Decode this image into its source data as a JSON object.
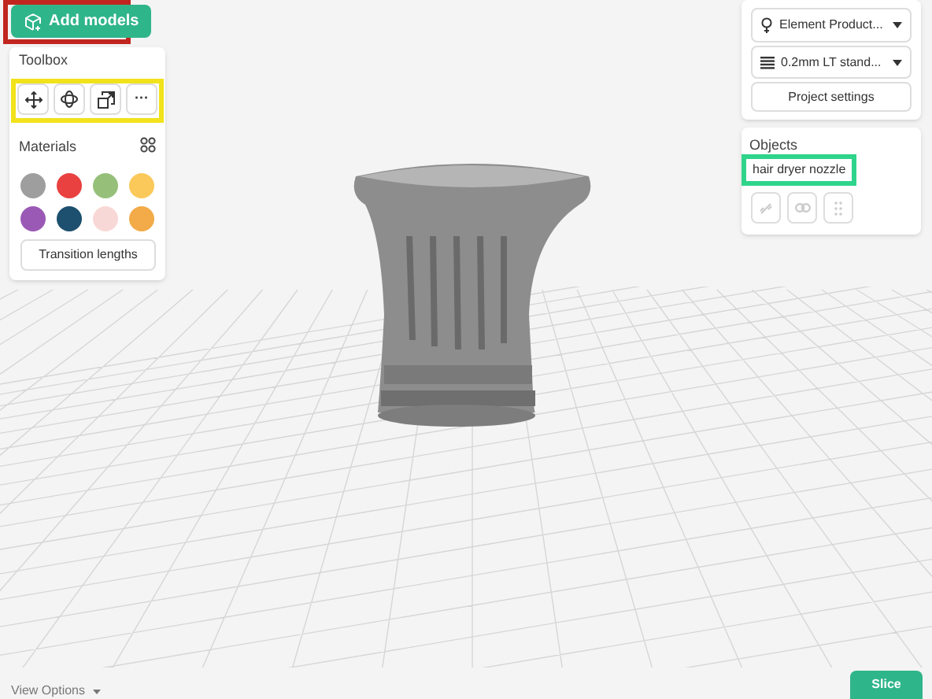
{
  "add_models_button": "Add models",
  "toolbox": {
    "title": "Toolbox",
    "tools": [
      {
        "kind": "move"
      },
      {
        "kind": "rotate"
      },
      {
        "kind": "scale"
      },
      {
        "kind": "more",
        "label": "···"
      }
    ]
  },
  "materials": {
    "title": "Materials",
    "swatches": [
      {
        "color": "#9e9e9e"
      },
      {
        "color": "#e8413f"
      },
      {
        "color": "#96c07a"
      },
      {
        "color": "#fbc95a"
      },
      {
        "color": "#9a59b5"
      },
      {
        "color": "#1d4f6e"
      },
      {
        "color": "#f8d8d6"
      },
      {
        "color": "#f2ab48"
      }
    ],
    "button": "Transition lengths"
  },
  "printer": {
    "printer_dropdown": "Element Product...",
    "profile_dropdown": "0.2mm LT stand...",
    "settings_button": "Project settings"
  },
  "objects": {
    "title": "Objects",
    "items": [
      "hair dryer nozzle"
    ]
  },
  "view_options": "View Options",
  "slice_button": "Slice"
}
